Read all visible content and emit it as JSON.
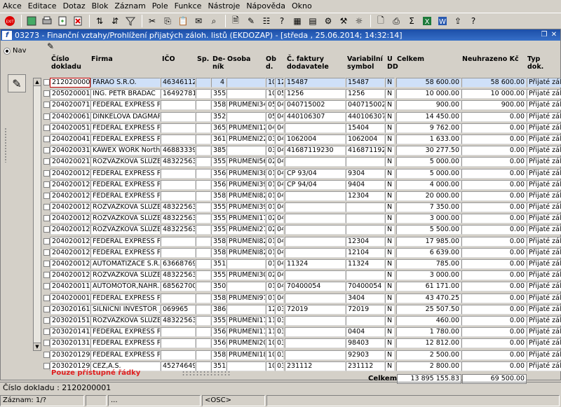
{
  "menu": [
    "Akce",
    "Editace",
    "Dotaz",
    "Blok",
    "Záznam",
    "Pole",
    "Funkce",
    "Nástroje",
    "Nápověda",
    "Okno"
  ],
  "window": {
    "title": "03273 - Finanční vztahy/Prohlížení přijatých záloh. listů (EKDOZAP) - [středa , 25.06.2014; 14:32:14]",
    "nav_label": "Nav"
  },
  "columns": {
    "doc": "Číslo\ndokladu",
    "firma": "Firma",
    "ico": "IČO",
    "sp": "Sp.",
    "denik": "De-\nník",
    "osoba": "Osoba",
    "obd": "Ob\nd.",
    "faktura": "Č. faktury\ndodavatele",
    "vs": "Variabilní\nsymbol",
    "udd": "U\nDD",
    "celkem": "Celkem",
    "neuhr": "Neuhrazeno Kč",
    "typ": "Typ\ndok."
  },
  "rows": [
    {
      "doc": "2120200001",
      "firma": "FARAO S.R.O.",
      "ico": "46346112",
      "sp": "",
      "denik": "4",
      "osoba": "",
      "o1": "10",
      "o2": "12",
      "fak": "15487",
      "vs": "15487",
      "udd": "N",
      "celkem": "58 600.00",
      "neuhr": "58 600.00",
      "typ": "Přijaté záloh"
    },
    {
      "doc": "2050200012",
      "firma": "ING. PETR BRADAC",
      "ico": "16492781",
      "sp": "",
      "denik": "355",
      "osoba": "",
      "o1": "10",
      "o2": "05",
      "fak": "1256",
      "vs": "1256",
      "udd": "N",
      "celkem": "10 000.00",
      "neuhr": "10 000.00",
      "typ": "Přijaté záloh"
    },
    {
      "doc": "2040200712",
      "firma": "FEDERAL EXPRESS PRG",
      "ico": "",
      "sp": "",
      "denik": "358",
      "osoba": "PRUMENI3491",
      "o1": "05",
      "o2": "04",
      "fak": "040715002",
      "vs": "040715002",
      "udd": "N",
      "celkem": "900.00",
      "neuhr": "900.00",
      "typ": "Přijaté záloh"
    },
    {
      "doc": "2040200612",
      "firma": "DINKELOVA DAGMAR zá",
      "ico": "",
      "sp": "",
      "denik": "352",
      "osoba": "",
      "o1": "05",
      "o2": "04",
      "fak": "440106307",
      "vs": "440106307",
      "udd": "N",
      "celkem": "14 450.00",
      "neuhr": "0.00",
      "typ": "Přijaté záloh"
    },
    {
      "doc": "2040200512",
      "firma": "FEDERAL EXPRESS PRG",
      "ico": "",
      "sp": "",
      "denik": "365",
      "osoba": "PRUMENI1223",
      "o1": "04",
      "o2": "04",
      "fak": "",
      "vs": "15404",
      "udd": "N",
      "celkem": "9 762.00",
      "neuhr": "0.00",
      "typ": "Přijaté záloh"
    },
    {
      "doc": "2040200412",
      "firma": "FEDERAL EXPRESS PRG",
      "ico": "",
      "sp": "",
      "denik": "361",
      "osoba": "PRUMENI2238",
      "o1": "03",
      "o2": "04",
      "fak": "1062004",
      "vs": "1062004",
      "udd": "N",
      "celkem": "1 633.00",
      "neuhr": "0.00",
      "typ": "Přijaté záloh"
    },
    {
      "doc": "2040200312",
      "firma": "KAWEX WORK North Ryc",
      "ico": "46883339",
      "sp": "",
      "denik": "385",
      "osoba": "",
      "o1": "03",
      "o2": "04",
      "fak": "41687119230",
      "vs": "4168711923",
      "udd": "N",
      "celkem": "30 277.50",
      "neuhr": "0.00",
      "typ": "Přijaté záloh"
    },
    {
      "doc": "2040200212",
      "firma": "ROZVAZKOVA SLUZBA",
      "ico": "48322563",
      "sp": "",
      "denik": "355",
      "osoba": "PRUMENI561 J",
      "o1": "02",
      "o2": "04",
      "fak": "",
      "vs": "",
      "udd": "N",
      "celkem": "5 000.00",
      "neuhr": "0.00",
      "typ": "Přijaté záloh"
    },
    {
      "doc": "2040200129",
      "firma": "FEDERAL EXPRESS PRG",
      "ico": "",
      "sp": "",
      "denik": "356",
      "osoba": "PRUMENI3812",
      "o1": "01",
      "o2": "04",
      "fak": "CP 93/04",
      "vs": "9304",
      "udd": "N",
      "celkem": "5 000.00",
      "neuhr": "0.00",
      "typ": "Přijaté záloh"
    },
    {
      "doc": "2040200128",
      "firma": "FEDERAL EXPRESS PRG",
      "ico": "",
      "sp": "",
      "denik": "356",
      "osoba": "PRUMENI3948",
      "o1": "01",
      "o2": "04",
      "fak": "CP 94/04",
      "vs": "9404",
      "udd": "N",
      "celkem": "4 000.00",
      "neuhr": "0.00",
      "typ": "Přijaté záloh"
    },
    {
      "doc": "2040200127",
      "firma": "FEDERAL EXPRESS PRG",
      "ico": "",
      "sp": "",
      "denik": "358",
      "osoba": "PRUMENI824 F",
      "o1": "01",
      "o2": "04",
      "fak": "",
      "vs": "12304",
      "udd": "N",
      "celkem": "20 000.00",
      "neuhr": "0.00",
      "typ": "Přijaté záloh"
    },
    {
      "doc": "2040200126",
      "firma": "ROZVAZKOVA SLUZBA",
      "ico": "48322563",
      "sp": "",
      "denik": "355",
      "osoba": "PRUMENI3965",
      "o1": "01",
      "o2": "04",
      "fak": "",
      "vs": "",
      "udd": "N",
      "celkem": "7 350.00",
      "neuhr": "0.00",
      "typ": "Přijaté záloh"
    },
    {
      "doc": "2040200125",
      "firma": "ROZVAZKOVA SLUZBA",
      "ico": "48322563",
      "sp": "",
      "denik": "355",
      "osoba": "PRUMENI1709",
      "o1": "02",
      "o2": "04",
      "fak": "",
      "vs": "",
      "udd": "N",
      "celkem": "3 000.00",
      "neuhr": "0.00",
      "typ": "Přijaté záloh"
    },
    {
      "doc": "2040200124",
      "firma": "ROZVAZKOVA SLUZBA",
      "ico": "48322563",
      "sp": "",
      "denik": "355",
      "osoba": "PRUMENI2748",
      "o1": "02",
      "o2": "04",
      "fak": "",
      "vs": "",
      "udd": "N",
      "celkem": "5 500.00",
      "neuhr": "0.00",
      "typ": "Přijaté záloh"
    },
    {
      "doc": "2040200123",
      "firma": "FEDERAL EXPRESS PRG",
      "ico": "",
      "sp": "",
      "denik": "358",
      "osoba": "PRUMENI824 F",
      "o1": "01",
      "o2": "04",
      "fak": "",
      "vs": "12304",
      "udd": "N",
      "celkem": "17 985.00",
      "neuhr": "0.00",
      "typ": "Přijaté záloh"
    },
    {
      "doc": "2040200122",
      "firma": "FEDERAL EXPRESS PRG",
      "ico": "",
      "sp": "",
      "denik": "358",
      "osoba": "PRUMENI824 F",
      "o1": "01",
      "o2": "04",
      "fak": "",
      "vs": "12104",
      "udd": "N",
      "celkem": "6 639.00",
      "neuhr": "0.00",
      "typ": "Přijaté záloh"
    },
    {
      "doc": "2040200121",
      "firma": "AUTOMATIZACE S.R.O.",
      "ico": "63668769",
      "sp": "",
      "denik": "351",
      "osoba": "",
      "o1": "01",
      "o2": "04",
      "fak": "11324",
      "vs": "11324",
      "udd": "N",
      "celkem": "785.00",
      "neuhr": "0.00",
      "typ": "Přijaté záloh"
    },
    {
      "doc": "2040200120",
      "firma": "ROZVAZKOVA SLUZBA",
      "ico": "48322563",
      "sp": "",
      "denik": "355",
      "osoba": "PRUMENI3062",
      "o1": "02",
      "o2": "04",
      "fak": "",
      "vs": "",
      "udd": "N",
      "celkem": "3 000.00",
      "neuhr": "0.00",
      "typ": "Přijaté záloh"
    },
    {
      "doc": "2040200112",
      "firma": "AUTOMOTOR,NAHR. DIL?",
      "ico": "68562700014",
      "sp": "",
      "denik": "350",
      "osoba": "",
      "o1": "01",
      "o2": "04",
      "fak": "70400054",
      "vs": "70400054",
      "udd": "N",
      "celkem": "61 171.00",
      "neuhr": "0.00",
      "typ": "Přijaté záloh"
    },
    {
      "doc": "2040200012",
      "firma": "FEDERAL EXPRESS PRG",
      "ico": "",
      "sp": "",
      "denik": "358",
      "osoba": "PRUMENI974 .",
      "o1": "01",
      "o2": "04",
      "fak": "",
      "vs": "3404",
      "udd": "N",
      "celkem": "43 470.25",
      "neuhr": "0.00",
      "typ": "Přijaté záloh"
    },
    {
      "doc": "2030201612",
      "firma": "SILNICNI INVESTOR _1",
      "ico": "069965",
      "sp": "",
      "denik": "386",
      "osoba": "",
      "o1": "12",
      "o2": "03",
      "fak": "72019",
      "vs": "72019",
      "udd": "N",
      "celkem": "25 507.50",
      "neuhr": "0.00",
      "typ": "Přijaté záloh"
    },
    {
      "doc": "2030201512",
      "firma": "ROZVAZKOVA SLUZBA",
      "ico": "48322563",
      "sp": "",
      "denik": "355",
      "osoba": "PRUMENI1731",
      "o1": "11",
      "o2": "03",
      "fak": "",
      "vs": "",
      "udd": "N",
      "celkem": "460.00",
      "neuhr": "0.00",
      "typ": "Přijaté záloh"
    },
    {
      "doc": "2030201412",
      "firma": "FEDERAL EXPRESS PRG",
      "ico": "",
      "sp": "",
      "denik": "356",
      "osoba": "PRUMENI1173",
      "o1": "11",
      "o2": "03",
      "fak": "",
      "vs": "0404",
      "udd": "N",
      "celkem": "1 780.00",
      "neuhr": "0.00",
      "typ": "Přijaté záloh"
    },
    {
      "doc": "2030201312",
      "firma": "FEDERAL EXPRESS PRG",
      "ico": "",
      "sp": "",
      "denik": "356",
      "osoba": "PRUMENI2046",
      "o1": "10",
      "o2": "03",
      "fak": "",
      "vs": "98403",
      "udd": "N",
      "celkem": "12 812.00",
      "neuhr": "0.00",
      "typ": "Přijaté záloh"
    },
    {
      "doc": "2030201299",
      "firma": "FEDERAL EXPRESS PRG",
      "ico": "",
      "sp": "",
      "denik": "358",
      "osoba": "PRUMENI1885",
      "o1": "10",
      "o2": "03",
      "fak": "",
      "vs": "92903",
      "udd": "N",
      "celkem": "2 500.00",
      "neuhr": "0.00",
      "typ": "Přijaté záloh"
    },
    {
      "doc": "2030201298",
      "firma": "CEZ,A.S.",
      "ico": "45274649",
      "sp": "",
      "denik": "351",
      "osoba": "",
      "o1": "10",
      "o2": "03",
      "fak": "231112",
      "vs": "231112",
      "udd": "N",
      "celkem": "2 800.00",
      "neuhr": "0.00",
      "typ": "Přijaté záloh"
    }
  ],
  "totals": {
    "label": "Celkem",
    "celkem": "13 895 155.83",
    "neuhr": "69 500.00"
  },
  "note": "Pouze přístupné řádky",
  "status": {
    "line1": "Číslo dokladu : 2120200001",
    "record": "Záznam: 1/?",
    "dots": "...",
    "osc": "<OSC>"
  },
  "colors": {
    "title_bar": "#1c4ea8",
    "selected_row": "#cfe0f8",
    "note": "#e02020"
  }
}
